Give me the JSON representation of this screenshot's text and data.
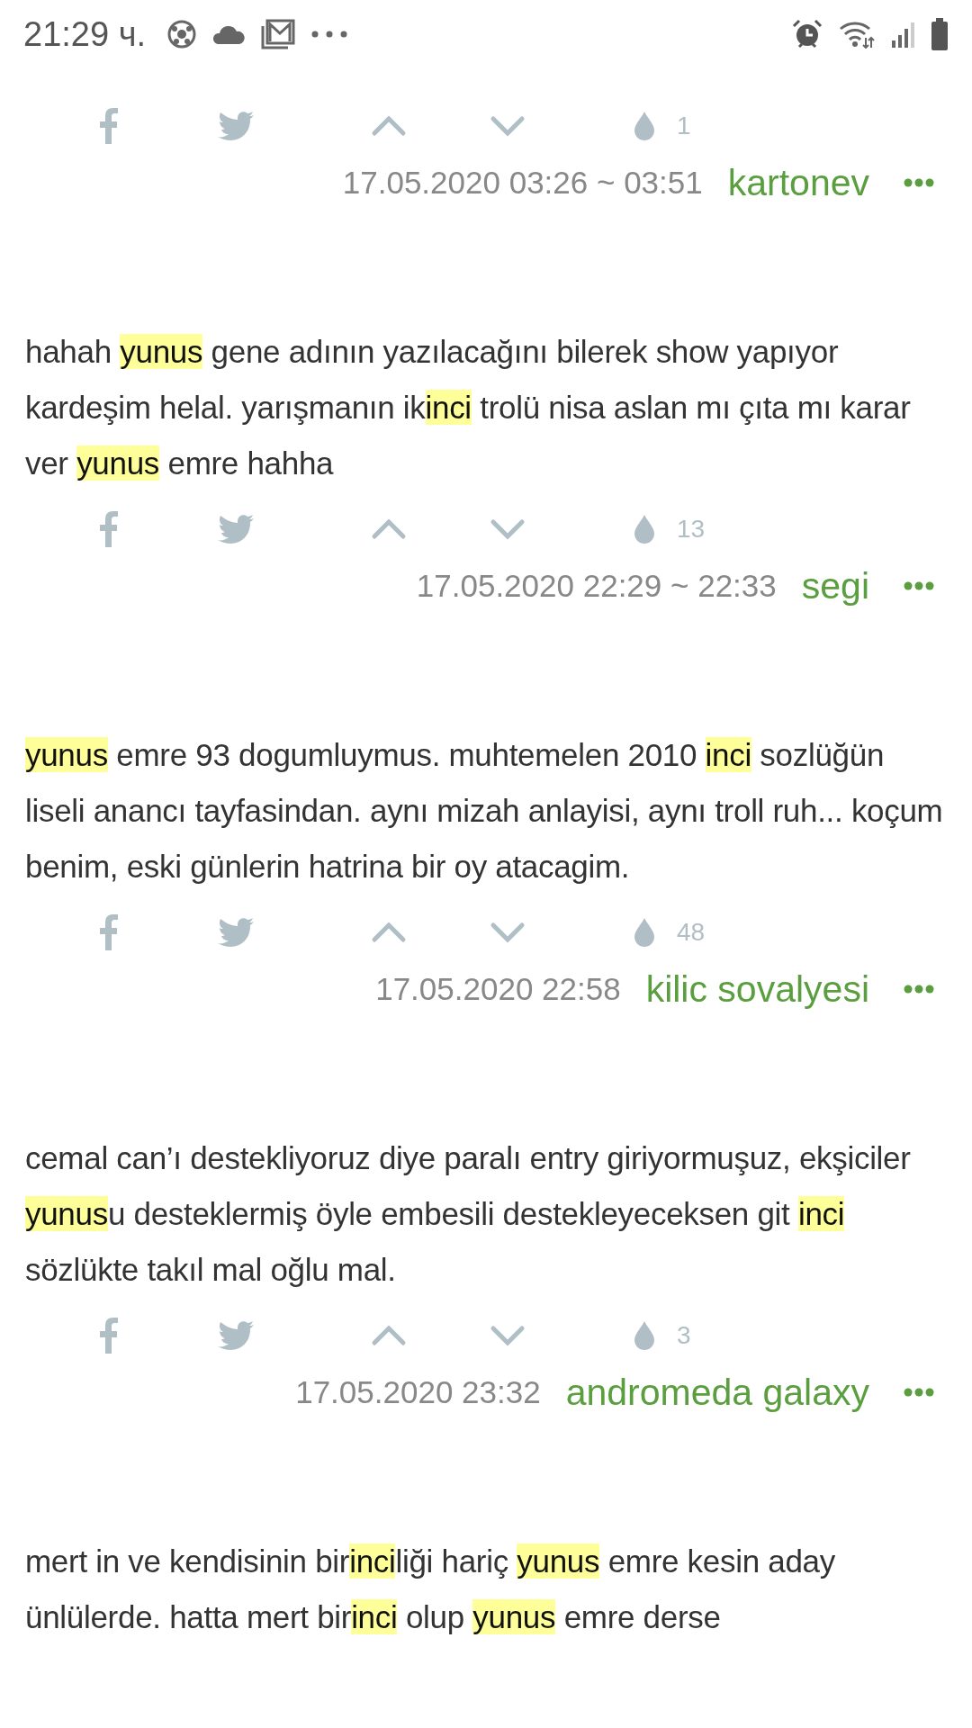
{
  "status_bar": {
    "time": "21:29 ч."
  },
  "entries": [
    {
      "favorites": "1",
      "date": "17.05.2020 03:26 ~ 03:51",
      "author": "kartonev"
    },
    {
      "segments": [
        {
          "text": "hahah "
        },
        {
          "text": "yunus",
          "highlight": true
        },
        {
          "text": " gene adının yazılacağını bilerek show yapıyor kardeşim helal. yarışmanın ik"
        },
        {
          "text": "inci",
          "highlight": true
        },
        {
          "text": " trolü nisa aslan mı çıta mı karar ver "
        },
        {
          "text": "yunus",
          "highlight": true
        },
        {
          "text": " emre hahha"
        }
      ],
      "favorites": "13",
      "date": "17.05.2020 22:29 ~ 22:33",
      "author": "segi"
    },
    {
      "segments": [
        {
          "text": "yunus",
          "highlight": true
        },
        {
          "text": " emre 93 dogumluymus. muhtemelen 2010 "
        },
        {
          "text": "inci",
          "highlight": true
        },
        {
          "text": " sozlüğün liseli anancı tayfasindan. aynı mizah anlayisi, aynı troll ruh... koçum benim, eski günlerin hatrina bir oy atacagim."
        }
      ],
      "favorites": "48",
      "date": "17.05.2020 22:58",
      "author": "kilic sovalyesi"
    },
    {
      "segments": [
        {
          "text": "cemal can’ı destekliyoruz diye paralı entry giriyormuşuz, ekşiciler "
        },
        {
          "text": "yunus",
          "highlight": true
        },
        {
          "text": "u desteklermiş öyle embesili destekleyeceksen git "
        },
        {
          "text": "inci",
          "highlight": true
        },
        {
          "text": " sözlükte takıl mal oğlu mal."
        }
      ],
      "favorites": "3",
      "date": "17.05.2020 23:32",
      "author": "andromeda galaxy"
    },
    {
      "segments": [
        {
          "text": "mert in ve kendisinin bir"
        },
        {
          "text": "inci",
          "highlight": true
        },
        {
          "text": "liği hariç "
        },
        {
          "text": "yunus",
          "highlight": true
        },
        {
          "text": " emre kesin aday ünlülerde. hatta mert bir"
        },
        {
          "text": "inci",
          "highlight": true
        },
        {
          "text": " olup "
        },
        {
          "text": "yunus",
          "highlight": true
        },
        {
          "text": " emre derse"
        }
      ]
    }
  ]
}
